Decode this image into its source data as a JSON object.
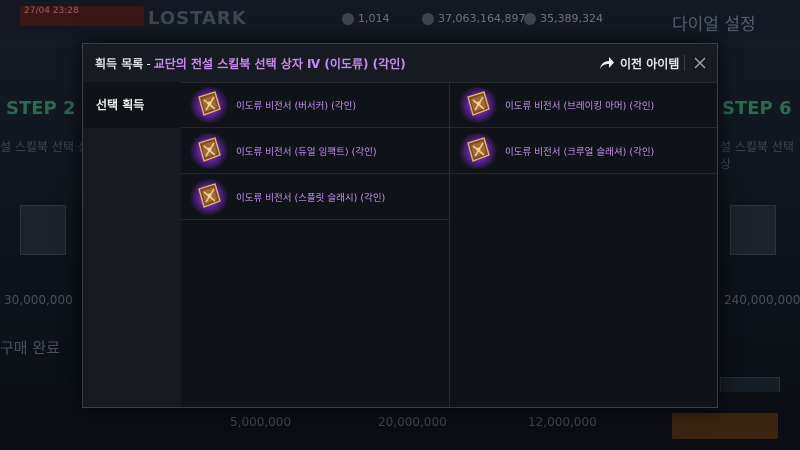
{
  "background": {
    "event_text": "27/04 23:28",
    "logo_text": "LOSTARK",
    "currencies": [
      "1,014",
      "37,063,164,897",
      "35,389,324"
    ],
    "right_title": "다이얼 설정",
    "steps": [
      "STEP 2",
      "STEP 6"
    ],
    "side_texts": [
      "설 스킬북 선택 상",
      "설 스킬북 선택 상"
    ],
    "prices": [
      "30,000,000",
      "240,000,000"
    ],
    "done_text": "구매 완료",
    "bottom_prices": [
      "5,000,000",
      "20,000,000",
      "12,000,000"
    ]
  },
  "modal": {
    "title_main": "획득 목록",
    "title_sep": "-",
    "title_sub": "교단의 전설 스킬북 선택 상자 Ⅳ (이도류) (각인)",
    "prev_label": "이전 아이템",
    "sidebar_tab": "선택 획득",
    "items": [
      {
        "label": "이도류 비전서 (버서커) (각인)",
        "icon": "engraving-book-icon"
      },
      {
        "label": "이도류 비전서 (브레이킹 아머) (각인)",
        "icon": "engraving-book-icon"
      },
      {
        "label": "이도류 비전서 (듀얼 임팩트) (각인)",
        "icon": "engraving-book-icon"
      },
      {
        "label": "이도류 비전서 (크루얼 슬래셔) (각인)",
        "icon": "engraving-book-icon"
      },
      {
        "label": "이도류 비전서 (스플릿 슬래시) (각인)",
        "icon": "engraving-book-icon"
      }
    ]
  },
  "colors": {
    "accent_purple": "#c58cf0",
    "item_label": "#c792ee",
    "icon_glow": "#aa46ff"
  }
}
